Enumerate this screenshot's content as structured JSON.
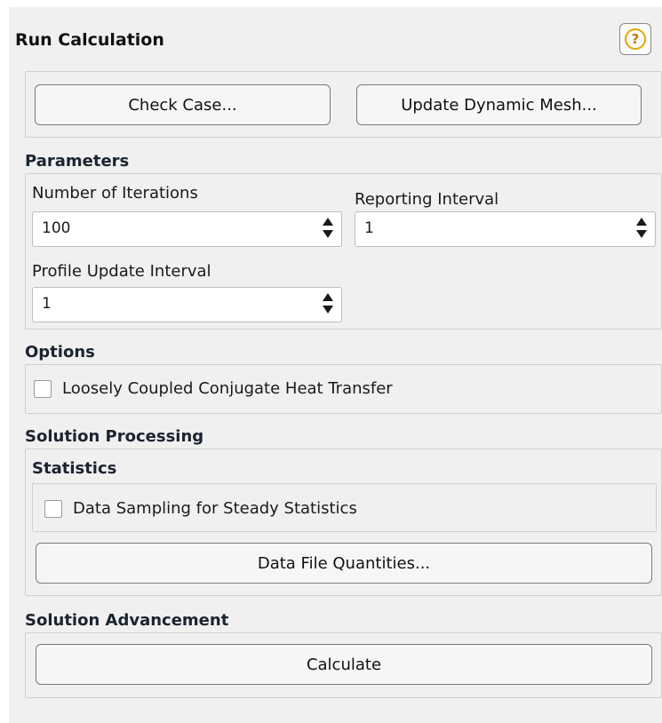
{
  "panel": {
    "title": "Run Calculation",
    "help_glyph": "?"
  },
  "top_buttons": {
    "check_case": "Check Case...",
    "update_dynamic_mesh": "Update Dynamic Mesh..."
  },
  "parameters": {
    "title": "Parameters",
    "number_of_iterations": {
      "label": "Number of Iterations",
      "value": "100"
    },
    "reporting_interval": {
      "label": "Reporting Interval",
      "value": "1"
    },
    "profile_update_interval": {
      "label": "Profile Update Interval",
      "value": "1"
    }
  },
  "options": {
    "title": "Options",
    "loosely_coupled": {
      "label": "Loosely Coupled Conjugate Heat Transfer",
      "checked": false
    }
  },
  "solution_processing": {
    "title": "Solution Processing",
    "statistics_title": "Statistics",
    "data_sampling": {
      "label": "Data Sampling for Steady Statistics",
      "checked": false
    },
    "data_file_quantities": "Data File Quantities..."
  },
  "solution_advancement": {
    "title": "Solution Advancement",
    "calculate": "Calculate"
  },
  "icons": {
    "help": "help-icon",
    "spinner_up": "chevron-up-icon",
    "spinner_down": "chevron-down-icon"
  },
  "colors": {
    "panel_bg": "#f0f0f0",
    "help_ring": "#e0a800",
    "section_title": "#1b2430"
  }
}
